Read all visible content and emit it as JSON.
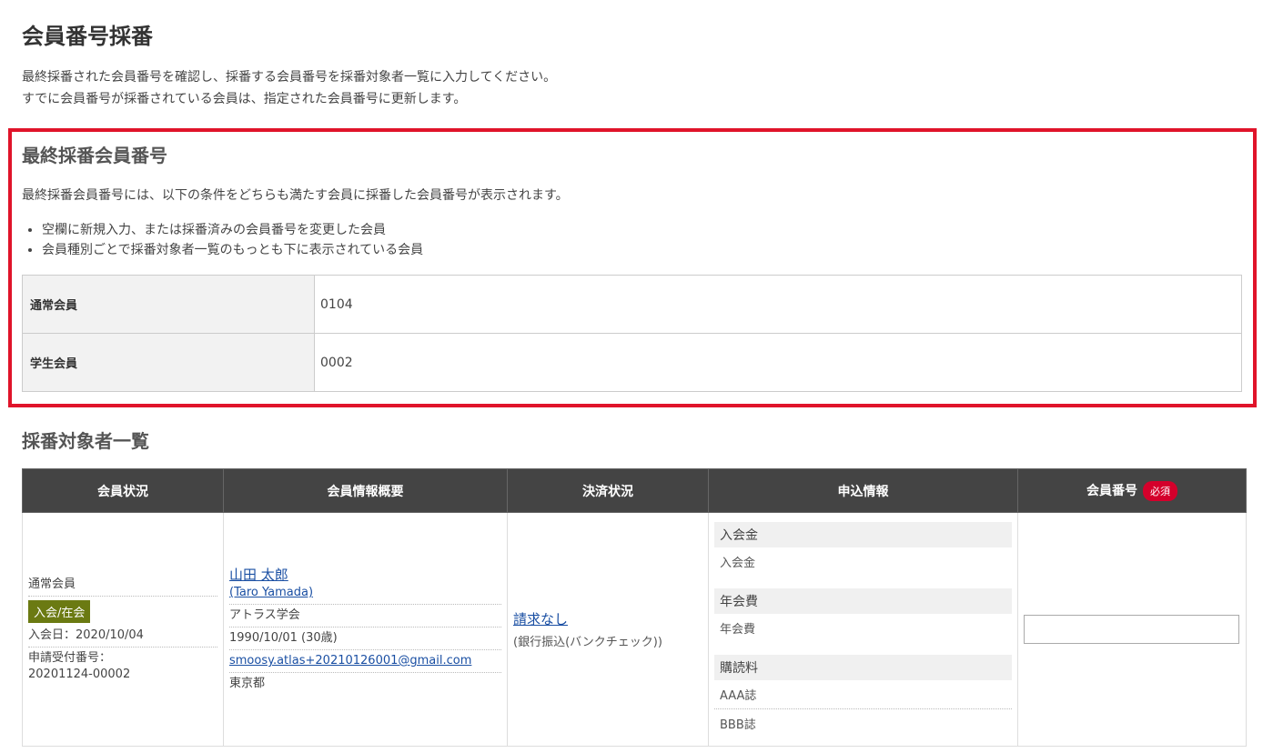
{
  "page": {
    "title": "会員番号採番",
    "intro_line1": "最終採番された会員番号を確認し、採番する会員番号を採番対象者一覧に入力してください。",
    "intro_line2": "すでに会員番号が採番されている会員は、指定された会員番号に更新します。"
  },
  "last_number": {
    "title": "最終採番会員番号",
    "desc": "最終採番会員番号には、以下の条件をどちらも満たす会員に採番した会員番号が表示されます。",
    "bullets": [
      "空欄に新規入力、または採番済みの会員番号を変更した会員",
      "会員種別ごとで採番対象者一覧のもっとも下に表示されている会員"
    ],
    "rows": [
      {
        "label": "通常会員",
        "value": "0104"
      },
      {
        "label": "学生会員",
        "value": "0002"
      }
    ]
  },
  "target_list": {
    "title": "採番対象者一覧",
    "headers": {
      "status": "会員状況",
      "info": "会員情報概要",
      "payment": "決済状況",
      "application": "申込情報",
      "number": "会員番号",
      "required": "必須"
    },
    "row": {
      "member_type": "通常会員",
      "status_badge": "入会/在会",
      "join_date": "入会日：2020/10/04",
      "app_no_label": "申請受付番号：",
      "app_no": "20201124-00002",
      "name": "山田 太郎",
      "name_en": "(Taro Yamada)",
      "org": "アトラス学会",
      "birth": "1990/10/01 (30歳)",
      "email": "smoosy.atlas+20210126001@gmail.com",
      "pref": "東京都",
      "payment_status": "請求なし",
      "payment_method": "(銀行振込(バンクチェック))",
      "app_groups": [
        {
          "head": "入会金",
          "items": [
            "入会金"
          ]
        },
        {
          "head": "年会費",
          "items": [
            "年会費"
          ]
        },
        {
          "head": "購読料",
          "items": [
            "AAA誌",
            "BBB誌"
          ]
        }
      ],
      "number_value": ""
    }
  }
}
